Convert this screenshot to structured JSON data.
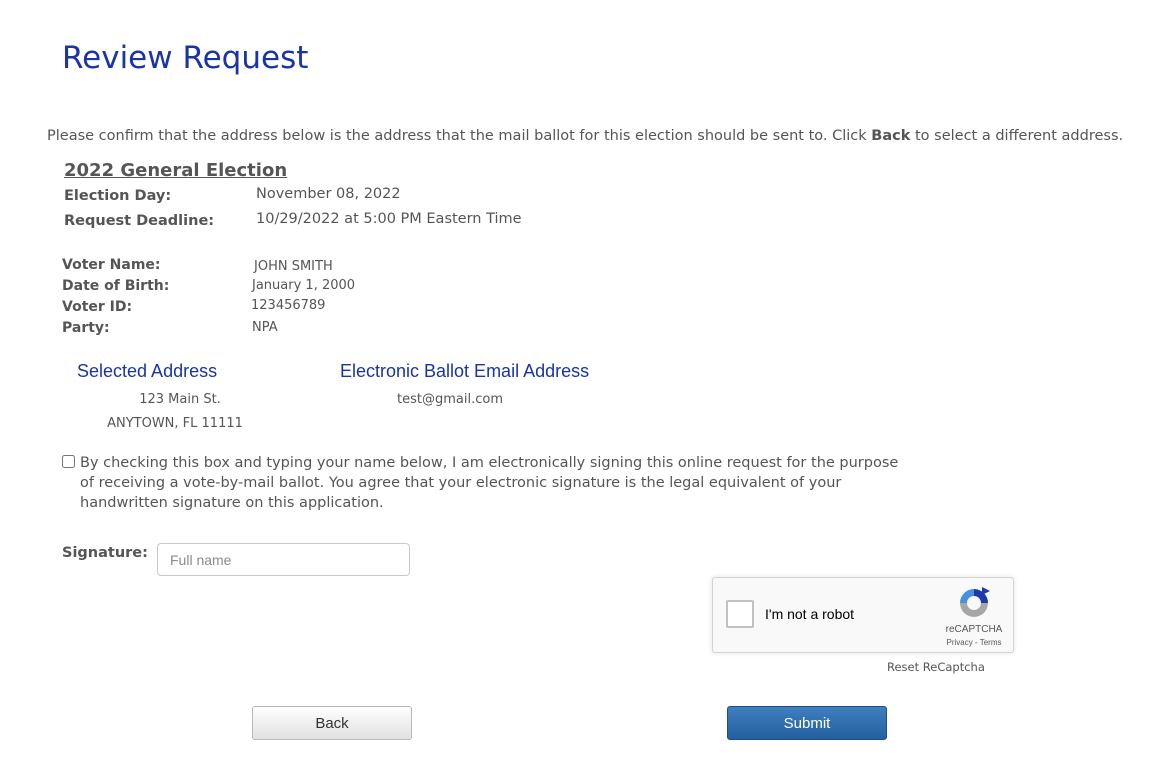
{
  "page": {
    "title": "Review Request"
  },
  "instructions": {
    "before": "Please confirm that the address below is the address that the mail ballot for this election should be sent to. Click ",
    "bold": "Back",
    "after": " to select a different address."
  },
  "election": {
    "name": "2022 General Election",
    "day_label": "Election Day:",
    "day_value": "November 08, 2022",
    "deadline_label": "Request Deadline:",
    "deadline_value": "10/29/2022 at 5:00 PM Eastern Time"
  },
  "voter": {
    "name_label": "Voter Name:",
    "name_value": "JOHN SMITH",
    "dob_label": "Date of Birth:",
    "dob_value": "January 1, 2000",
    "id_label": "Voter ID:",
    "id_value": "123456789",
    "party_label": "Party:",
    "party_value": "NPA"
  },
  "address": {
    "heading": "Selected Address",
    "line1": "123 Main St.",
    "line2": "ANYTOWN, FL 11111"
  },
  "email": {
    "heading": "Electronic Ballot Email Address",
    "value": "test@gmail.com"
  },
  "consent": {
    "checked": false,
    "text": "By checking this box and typing your name below, I am electronically signing this online request for the purpose of receiving a vote-by-mail ballot. You agree that your electronic signature is the legal equivalent of your handwritten signature on this application."
  },
  "signature": {
    "label": "Signature:",
    "value": "",
    "placeholder": "Full name"
  },
  "recaptcha": {
    "label": "I'm not a robot",
    "brand": "reCAPTCHA",
    "links": "Privacy - Terms",
    "reset_label": "Reset ReCaptcha"
  },
  "buttons": {
    "back": "Back",
    "submit": "Submit"
  },
  "colors": {
    "heading_blue": "#1a33a8",
    "submit_blue": "#2e6dac",
    "text_gray": "#555555"
  }
}
